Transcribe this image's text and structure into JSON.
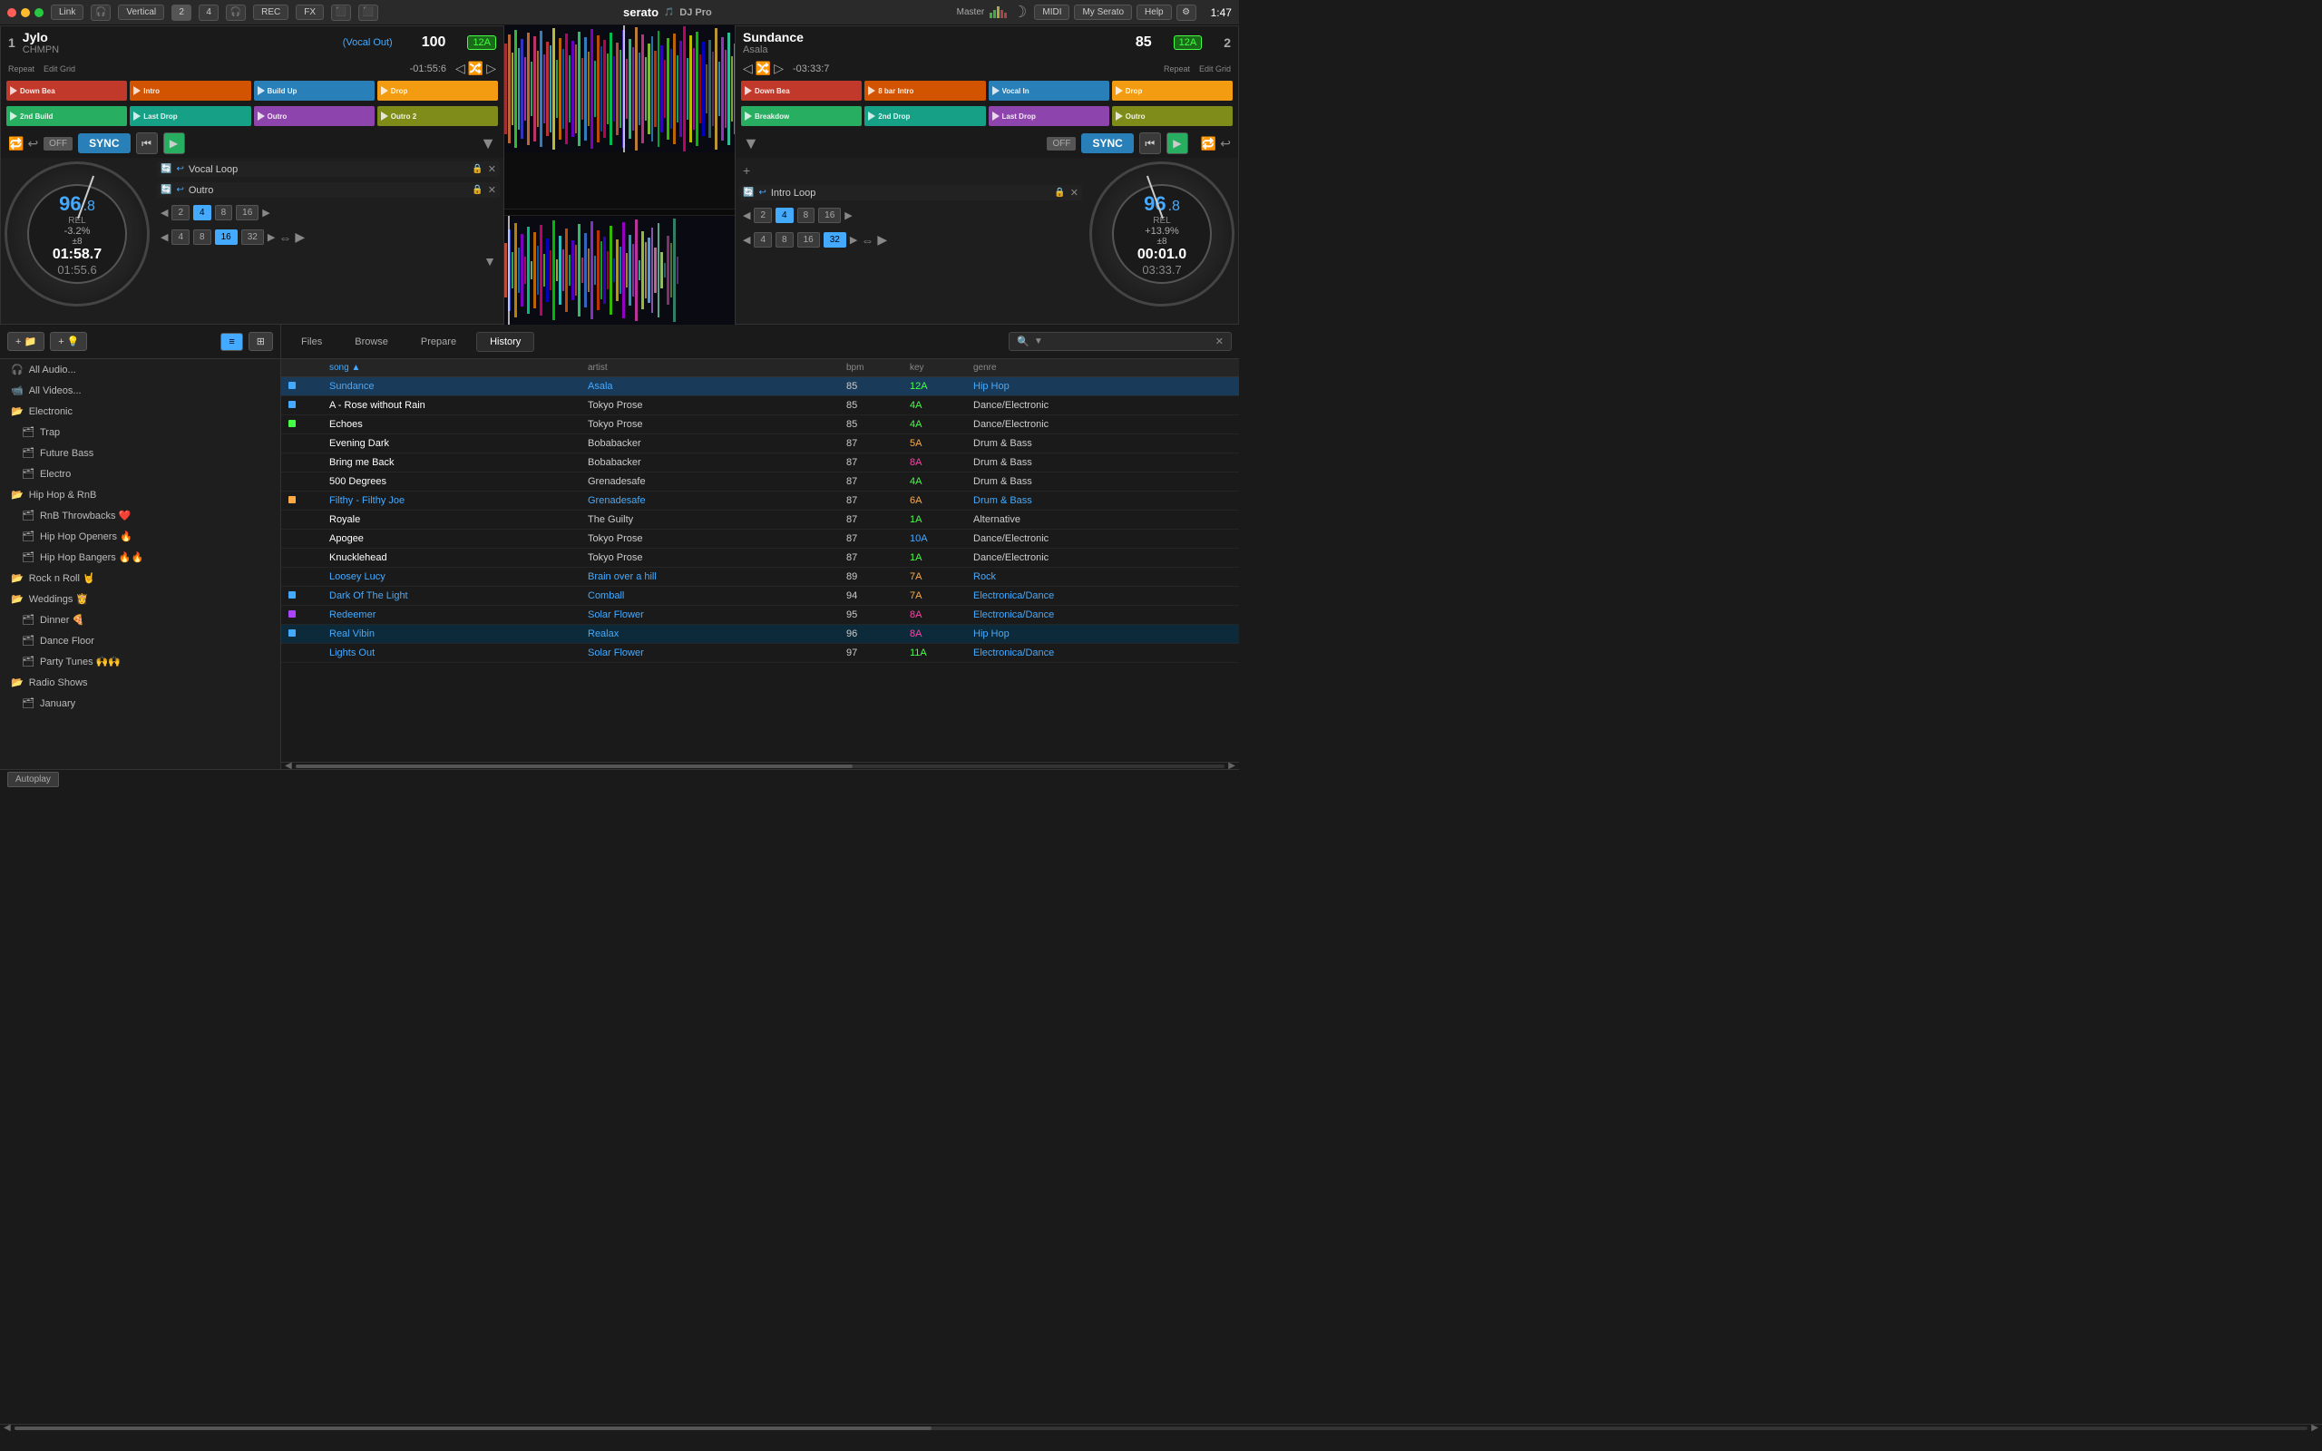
{
  "topbar": {
    "link_label": "Link",
    "vertical_label": "Vertical",
    "rec_label": "REC",
    "fx_label": "FX",
    "logo_text": "serato",
    "dj_pro": "DJ Pro",
    "master_label": "Master",
    "midi_label": "MIDI",
    "my_serato_label": "My Serato",
    "help_label": "Help",
    "time": "1:47"
  },
  "deck1": {
    "number": "1",
    "title": "Jylo",
    "artist": "CHMPN",
    "cue_label": "(Vocal Out)",
    "bpm": "100",
    "key": "12A",
    "repeat": "Repeat",
    "edit_grid": "Edit Grid",
    "time_remaining": "-01:55:6",
    "time1": "01:58.7",
    "time2": "01:55.6",
    "bpm_platter": "96",
    "bpm_decimal": ".8",
    "rel_label": "REL",
    "pitch": "-3.2%",
    "pm_range": "±8",
    "cues": [
      {
        "label": "Down Bea",
        "color": "cue-red"
      },
      {
        "label": "Intro",
        "color": "cue-orange"
      },
      {
        "label": "Build Up",
        "color": "cue-blue"
      },
      {
        "label": "Drop",
        "color": "cue-yellow"
      },
      {
        "label": "2nd Build",
        "color": "cue-green"
      },
      {
        "label": "Last Drop",
        "color": "cue-teal"
      },
      {
        "label": "Outro",
        "color": "cue-purple"
      },
      {
        "label": "Outro 2",
        "color": "cue-olive"
      }
    ],
    "loops": [
      {
        "label": "Vocal Loop"
      },
      {
        "label": "Outro"
      }
    ],
    "beat_btns": [
      "2",
      "4",
      "8",
      "16"
    ],
    "beat_btns2": [
      "4",
      "8",
      "16",
      "32"
    ]
  },
  "deck2": {
    "number": "2",
    "title": "Sundance",
    "artist": "Asala",
    "bpm": "85",
    "key": "12A",
    "repeat": "Repeat",
    "edit_grid": "Edit Grid",
    "time_remaining": "-03:33:7",
    "time1": "00:01.0",
    "time2": "03:33.7",
    "bpm_platter": "96",
    "bpm_decimal": ".8",
    "rel_label": "REL",
    "pitch": "+13.9%",
    "pm_range": "±8",
    "cues": [
      {
        "label": "Down Bea",
        "color": "cue-red"
      },
      {
        "label": "8 bar Intro",
        "color": "cue-orange"
      },
      {
        "label": "Vocal In",
        "color": "cue-blue"
      },
      {
        "label": "Drop",
        "color": "cue-yellow"
      },
      {
        "label": "Breakdow",
        "color": "cue-green"
      },
      {
        "label": "2nd Drop",
        "color": "cue-teal"
      },
      {
        "label": "Last Drop",
        "color": "cue-purple"
      },
      {
        "label": "Outro",
        "color": "cue-olive"
      }
    ],
    "loops": [
      {
        "label": "Intro Loop"
      }
    ],
    "beat_btns": [
      "2",
      "4",
      "8",
      "16"
    ],
    "beat_btns2": [
      "4",
      "8",
      "16",
      "32"
    ]
  },
  "browser": {
    "tabs": [
      "Files",
      "Browse",
      "Prepare",
      "History"
    ],
    "active_tab": "History",
    "search_placeholder": "",
    "columns": {
      "song": "song",
      "artist": "artist",
      "bpm": "bpm",
      "key": "key",
      "genre": "genre"
    },
    "tracks": [
      {
        "song": "Sundance",
        "artist": "Asala",
        "bpm": "85",
        "key": "12A",
        "genre": "Hip Hop",
        "highlight": true,
        "song_color": "cyan",
        "artist_color": "cyan",
        "genre_color": "cyan",
        "key_color": "green",
        "indicator": "blue"
      },
      {
        "song": "A - Rose without Rain",
        "artist": "Tokyo Prose",
        "bpm": "85",
        "key": "4A",
        "genre": "Dance/Electronic",
        "indicator": "blue"
      },
      {
        "song": "Echoes",
        "artist": "Tokyo Prose",
        "bpm": "85",
        "key": "4A",
        "genre": "Dance/Electronic",
        "indicator": "green"
      },
      {
        "song": "Evening Dark",
        "artist": "Bobabacker",
        "bpm": "87",
        "key": "5A",
        "genre": "Drum & Bass",
        "key_color": "orange"
      },
      {
        "song": "Bring me Back",
        "artist": "Bobabacker",
        "bpm": "87",
        "key": "8A",
        "genre": "Drum & Bass",
        "key_color": "pink"
      },
      {
        "song": "500 Degrees",
        "artist": "Grenadesafe",
        "bpm": "87",
        "key": "4A",
        "genre": "Drum & Bass"
      },
      {
        "song": "Filthy - Filthy Joe",
        "artist": "Grenadesafe",
        "bpm": "87",
        "key": "6A",
        "genre": "Drum & Bass",
        "highlight": false,
        "song_color": "cyan",
        "artist_color": "cyan",
        "genre_color": "cyan",
        "key_color": "orange",
        "indicator": "yellow"
      },
      {
        "song": "Royale",
        "artist": "The Guilty",
        "bpm": "87",
        "key": "1A",
        "genre": "Alternative"
      },
      {
        "song": "Apogee",
        "artist": "Tokyo Prose",
        "bpm": "87",
        "key": "10A",
        "genre": "Dance/Electronic"
      },
      {
        "song": "Knucklehead",
        "artist": "Tokyo Prose",
        "bpm": "87",
        "key": "1A",
        "genre": "Dance/Electronic"
      },
      {
        "song": "Loosey Lucy",
        "artist": "Brain over a hill",
        "bpm": "89",
        "key": "7A",
        "genre": "Rock",
        "song_color": "cyan",
        "artist_color": "cyan",
        "genre_color": "cyan",
        "key_color": "orange"
      },
      {
        "song": "Dark Of The Light",
        "artist": "Comball",
        "bpm": "94",
        "key": "7A",
        "genre": "Electronica/Dance",
        "song_color": "cyan",
        "artist_color": "cyan",
        "genre_color": "cyan",
        "key_color": "orange",
        "indicator": "blue"
      },
      {
        "song": "Redeemer",
        "artist": "Solar Flower",
        "bpm": "95",
        "key": "8A",
        "genre": "Electronica/Dance",
        "song_color": "cyan",
        "artist_color": "cyan",
        "genre_color": "cyan",
        "key_color": "pink",
        "indicator": "purple"
      },
      {
        "song": "Real Vibin",
        "artist": "Realax",
        "bpm": "96",
        "key": "8A",
        "genre": "Hip Hop",
        "playing": true,
        "song_color": "cyan",
        "artist_color": "cyan",
        "genre_color": "cyan",
        "key_color": "pink",
        "indicator": "blue"
      },
      {
        "song": "Lights Out",
        "artist": "Solar Flower",
        "bpm": "97",
        "key": "11A",
        "genre": "Electronica/Dance",
        "song_color": "cyan",
        "artist_color": "cyan",
        "genre_color": "cyan"
      }
    ]
  },
  "sidebar": {
    "items": [
      {
        "label": "All Audio...",
        "icon": "🎵",
        "level": 0
      },
      {
        "label": "All Videos...",
        "icon": "🎬",
        "level": 0
      },
      {
        "label": "Electronic",
        "icon": "📁",
        "level": 0,
        "open": true
      },
      {
        "label": "Trap",
        "icon": "🗂",
        "level": 1
      },
      {
        "label": "Future Bass",
        "icon": "🗂",
        "level": 1
      },
      {
        "label": "Electro",
        "icon": "🗂",
        "level": 1
      },
      {
        "label": "Hip Hop & RnB",
        "icon": "📁",
        "level": 0,
        "open": true
      },
      {
        "label": "RnB Throwbacks ❤️",
        "icon": "🗂",
        "level": 1
      },
      {
        "label": "Hip Hop Openers 🔥",
        "icon": "🗂",
        "level": 1
      },
      {
        "label": "Hip Hop Bangers 🔥🔥",
        "icon": "🗂",
        "level": 1
      },
      {
        "label": "Rock n Roll 🤘",
        "icon": "📁",
        "level": 0
      },
      {
        "label": "Weddings 👸",
        "icon": "📁",
        "level": 0,
        "open": true
      },
      {
        "label": "Dinner 🍕",
        "icon": "🗂",
        "level": 1
      },
      {
        "label": "Dance Floor",
        "icon": "🗂",
        "level": 1
      },
      {
        "label": "Party Tunes 🙌🙌",
        "icon": "🗂",
        "level": 1
      },
      {
        "label": "Radio Shows",
        "icon": "📁",
        "level": 0,
        "open": true
      },
      {
        "label": "January",
        "icon": "🗂",
        "level": 1
      }
    ]
  },
  "autoplay": "Autoplay"
}
